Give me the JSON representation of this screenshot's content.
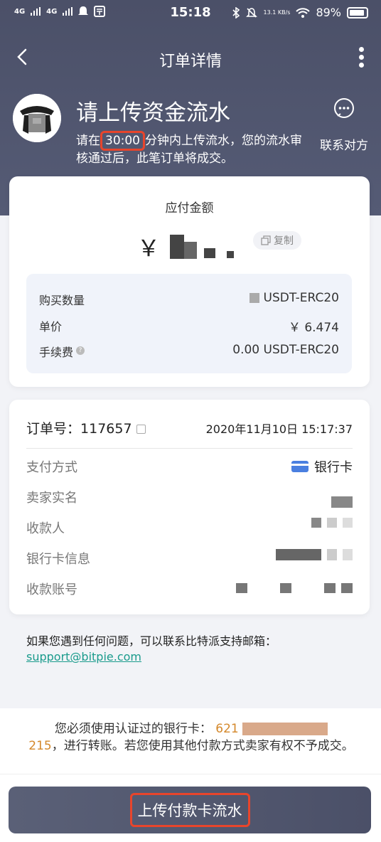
{
  "status_bar": {
    "signal1": "4G",
    "signal2": "4G",
    "time": "15:18",
    "net_speed": "13.1 KB/s",
    "battery": "89%"
  },
  "nav": {
    "title": "订单详情"
  },
  "hero": {
    "title": "请上传资金流水",
    "desc_prefix": "请在",
    "timer": "30:00",
    "desc_suffix": "分钟内上传流水，您的流水审核通过后，此笔订单将成交。",
    "contact_label": "联系对方"
  },
  "payment": {
    "amount_label": "应付金额",
    "currency_symbol": "￥",
    "copy_label": "复制",
    "rows": [
      {
        "label": "购买数量",
        "value": "USDT-ERC20"
      },
      {
        "label": "单价",
        "value": "￥ 6.474"
      },
      {
        "label": "手续费",
        "value": "0.00 USDT-ERC20"
      }
    ]
  },
  "order": {
    "number_label": "订单号：",
    "number": "117657",
    "date": "2020年11月10日 15:17:37",
    "fields": [
      {
        "label": "支付方式",
        "value": "银行卡"
      },
      {
        "label": "卖家实名",
        "value": ""
      },
      {
        "label": "收款人",
        "value": ""
      },
      {
        "label": "银行卡信息",
        "value": ""
      },
      {
        "label": "收款账号",
        "value": ""
      }
    ]
  },
  "support": {
    "text": "如果您遇到任何问题，可以联系比特派支持邮箱：",
    "email": "support@bitpie.com"
  },
  "notice": {
    "prefix": "您必须使用认证过的银行卡：",
    "card_start": "621",
    "card_end": "215",
    "suffix": "，进行转账。若您使用其他付款方式卖家有权不予成交。"
  },
  "action": {
    "upload_label": "上传付款卡流水"
  }
}
